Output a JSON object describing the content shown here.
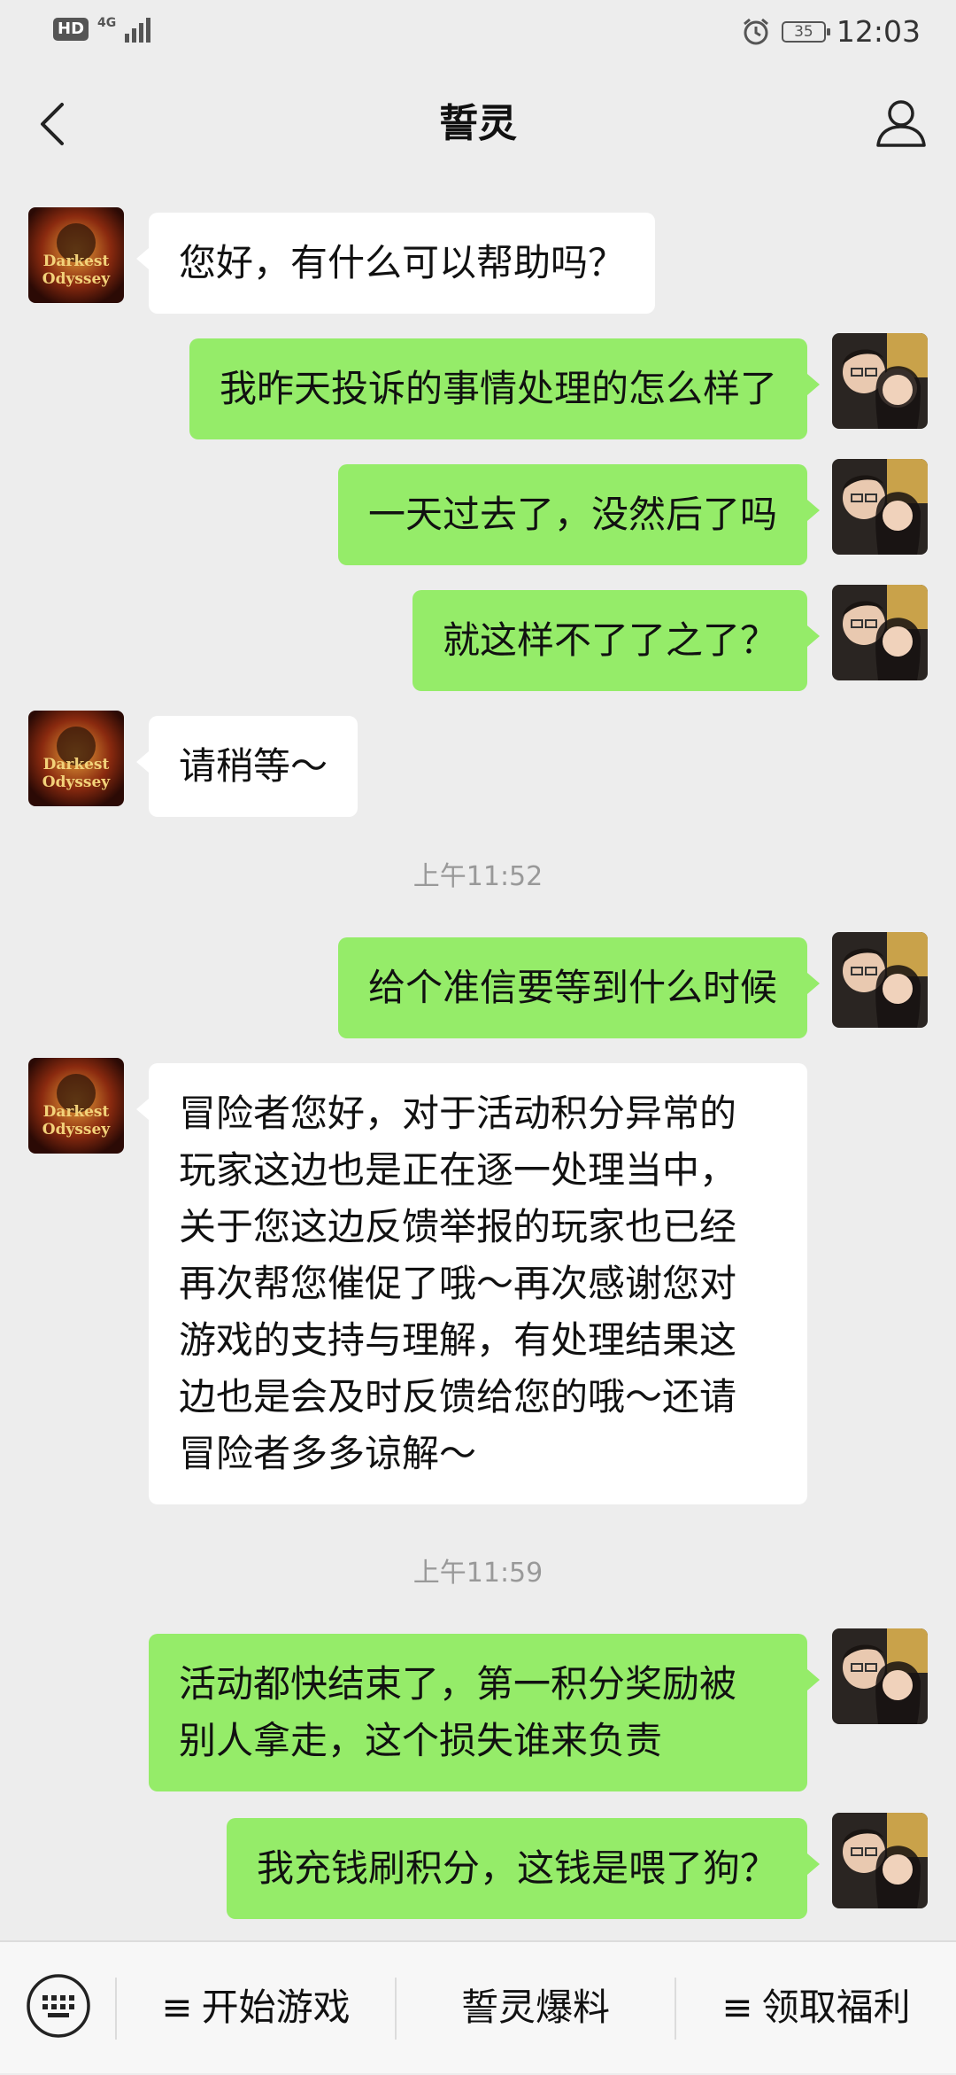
{
  "status_bar": {
    "network_badge": "HD",
    "network_type": "4G",
    "battery": "35",
    "time": "12:03"
  },
  "nav": {
    "title": "誓灵",
    "back_icon": "chevron-left-icon",
    "profile_icon": "person-icon"
  },
  "messages": [
    {
      "side": "left",
      "text": "您好，有什么可以帮助吗？"
    },
    {
      "side": "right",
      "text": "我昨天投诉的事情处理的怎么样了"
    },
    {
      "side": "right",
      "text": "一天过去了，没然后了吗"
    },
    {
      "side": "right",
      "text": "就这样不了了之了？"
    },
    {
      "side": "left",
      "text": "请稍等～"
    },
    {
      "timestamp": "上午11:52"
    },
    {
      "side": "right",
      "text": "给个准信要等到什么时候"
    },
    {
      "side": "left",
      "text": "冒险者您好，对于活动积分异常的\n玩家这边也是正在逐一处理当中，\n关于您这边反馈举报的玩家也已经\n再次帮您催促了哦～再次感谢您对\n游戏的支持与理解，有处理结果这\n边也是会及时反馈给您的哦～还请\n冒险者多多谅解～"
    },
    {
      "timestamp": "上午11:59"
    },
    {
      "side": "right",
      "text": "活动都快结束了，第一积分奖励被\n别人拿走，这个损失谁来负责"
    },
    {
      "side": "right",
      "text": "我充钱刷积分，这钱是喂了狗？"
    }
  ],
  "avatar_service": {
    "line1": "Darkest",
    "line2": "Odyssey"
  },
  "menu": {
    "keyboard_icon": "keyboard-icon",
    "items": [
      {
        "prefix": "≡",
        "label": "开始游戏"
      },
      {
        "prefix": "",
        "label": "誓灵爆料"
      },
      {
        "prefix": "≡",
        "label": "领取福利"
      }
    ]
  },
  "colors": {
    "background": "#ededed",
    "bubble_self": "#95ec69",
    "bubble_other": "#ffffff"
  }
}
